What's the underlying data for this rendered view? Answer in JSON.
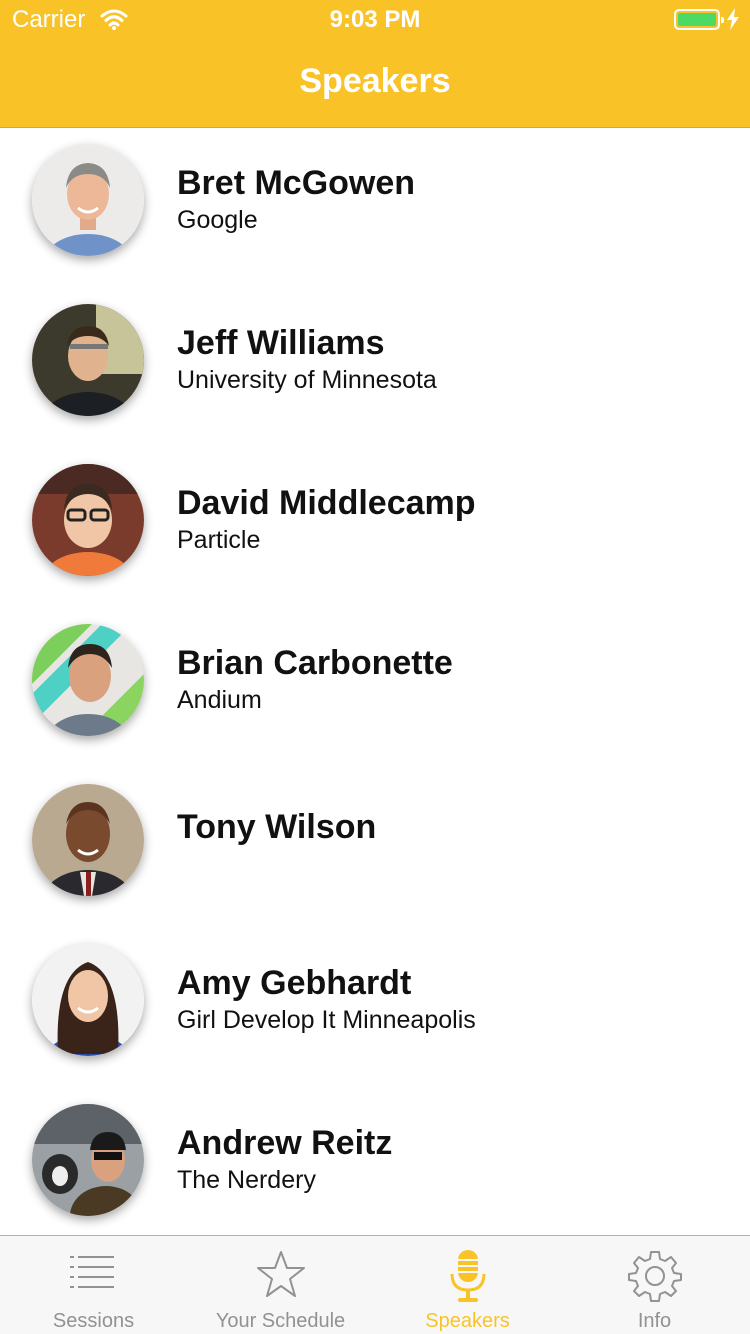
{
  "status_bar": {
    "carrier": "Carrier",
    "time": "9:03 PM"
  },
  "header": {
    "title": "Speakers"
  },
  "speakers": [
    {
      "name": "Bret McGowen",
      "affiliation": "Google"
    },
    {
      "name": "Jeff Williams",
      "affiliation": "University of Minnesota"
    },
    {
      "name": "David Middlecamp",
      "affiliation": "Particle"
    },
    {
      "name": "Brian Carbonette",
      "affiliation": "Andium"
    },
    {
      "name": "Tony Wilson",
      "affiliation": ""
    },
    {
      "name": "Amy Gebhardt",
      "affiliation": "Girl Develop It Minneapolis"
    },
    {
      "name": "Andrew Reitz",
      "affiliation": "The Nerdery"
    }
  ],
  "tabbar": {
    "tabs": [
      {
        "label": "Sessions",
        "icon": "list-icon"
      },
      {
        "label": "Your Schedule",
        "icon": "star-icon"
      },
      {
        "label": "Speakers",
        "icon": "microphone-icon"
      },
      {
        "label": "Info",
        "icon": "gear-icon"
      }
    ],
    "active_index": 2
  },
  "colors": {
    "accent": "#f9c328",
    "inactive": "#929292",
    "battery": "#4cd964"
  }
}
